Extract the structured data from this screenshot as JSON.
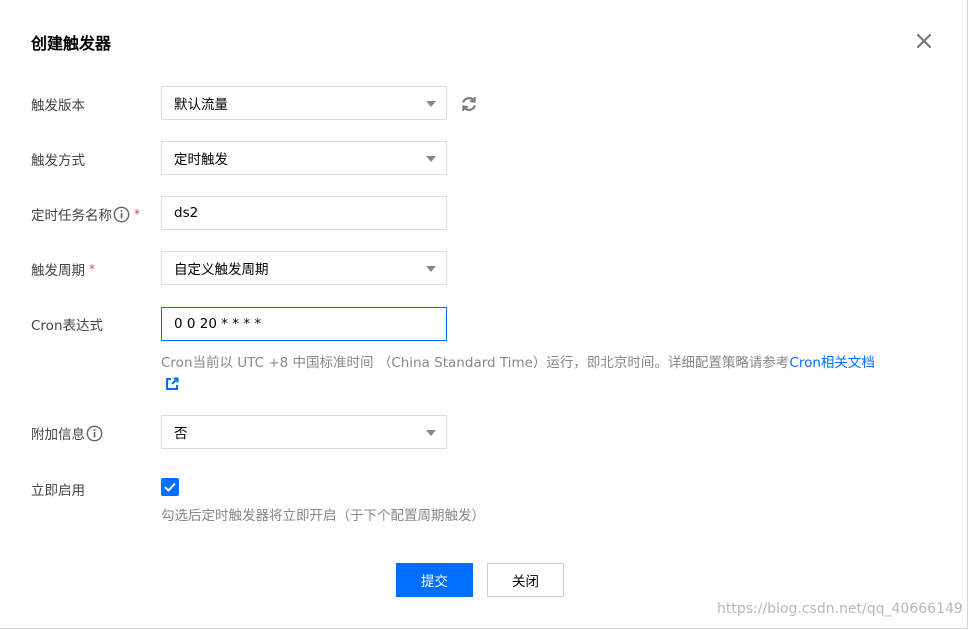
{
  "dialog": {
    "title": "创建触发器",
    "close_icon": "close-icon"
  },
  "form": {
    "version": {
      "label": "触发版本",
      "value": "默认流量",
      "refresh_icon": "refresh-icon"
    },
    "method": {
      "label": "触发方式",
      "value": "定时触发"
    },
    "task_name": {
      "label": "定时任务名称",
      "required_mark": "*",
      "value": "ds2",
      "info_icon": "info-icon"
    },
    "period": {
      "label": "触发周期",
      "required_mark": "*",
      "value": "自定义触发周期"
    },
    "cron": {
      "label": "Cron表达式",
      "value": "0 0 20 * * * *",
      "hint": "Cron当前以 UTC +8 中国标准时间 （China Standard Time）运行，即北京时间。详细配置策略请参考",
      "hint_link": "Cron相关文档",
      "link_icon": "external-link-icon"
    },
    "extra_info": {
      "label": "附加信息",
      "value": "否",
      "info_icon": "info-icon"
    },
    "enable_now": {
      "label": "立即启用",
      "checked": true,
      "hint": "勾选后定时触发器将立即开启（于下个配置周期触发）"
    }
  },
  "buttons": {
    "submit_label": "提交",
    "close_label": "关闭"
  },
  "watermark": "https://blog.csdn.net/qq_40666149",
  "colors": {
    "primary": "#006eff",
    "required": "#e54545",
    "label": "#444444",
    "hint": "#888888"
  }
}
